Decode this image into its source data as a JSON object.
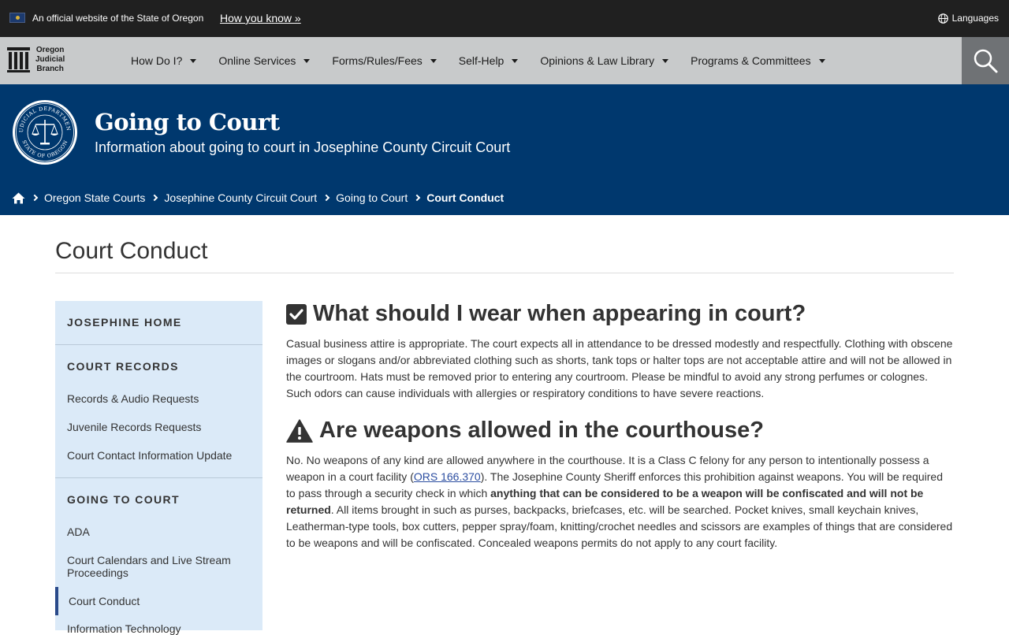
{
  "banner": {
    "official_text": "An official website of the State of Oregon",
    "how_you_know": "How you know »",
    "languages": "Languages"
  },
  "logo": {
    "line1": "Oregon",
    "line2": "Judicial",
    "line3": "Branch"
  },
  "nav": {
    "items": [
      {
        "label": "How Do I?"
      },
      {
        "label": "Online Services"
      },
      {
        "label": "Forms/Rules/Fees"
      },
      {
        "label": "Self-Help"
      },
      {
        "label": "Opinions & Law Library"
      },
      {
        "label": "Programs & Committees"
      }
    ]
  },
  "hero": {
    "title": "Going to Court",
    "subtitle": "Information about going to court in Josephine County Circuit Court",
    "seal_top": "JUDICIAL DEPARTMENT",
    "seal_bottom": "STATE OF OREGON"
  },
  "breadcrumb": {
    "items": [
      "Oregon State Courts",
      "Josephine County Circuit Court",
      "Going to Court"
    ],
    "current": "Court Conduct"
  },
  "page": {
    "title": "Court Conduct"
  },
  "sidebar": {
    "home": "JOSEPHINE HOME",
    "records_heading": "COURT RECORDS",
    "records_links": [
      "Records & Audio Requests",
      "Juvenile Records Requests",
      "Court Contact Information Update"
    ],
    "going_heading": "GOING TO COURT",
    "going_links": [
      "ADA",
      "Court Calendars and Live Stream Proceedings",
      "Court Conduct",
      "Information Technology"
    ]
  },
  "content": {
    "q1": "What should I wear when appearing in court?",
    "a1": "Casual business attire is appropriate. The court expects all in attendance to be dressed modestly and respectfully. Clothing with obscene images or slogans and/or abbreviated clothing such as shorts, tank tops or halter tops are not acceptable attire and will not be allowed in the courtroom. Hats must be removed prior to entering any courtroom. Please be mindful to avoid any strong perfumes or colognes. Such odors can cause individuals with allergies or respiratory conditions to have severe reactions.",
    "q2": "Are weapons allowed in the courthouse?",
    "a2_part1": "No. No weapons of any kind are allowed anywhere in the courthouse. It is a Class C felony for any person to intentionally possess a weapon in a court facility (",
    "a2_link": "ORS 166.370",
    "a2_part2": "). The Josephine County Sheriff enforces this prohibition against weapons. You will be required to pass through a security check in which ",
    "a2_bold": "anything that can be considered to be a weapon will be confiscated and will not be returned",
    "a2_part3": ". All items brought in such as purses, backpacks, briefcases, etc. will be searched. Pocket knives, small keychain knives, Leatherman-type tools, box cutters, pepper spray/foam, knitting/crochet needles and scissors are examples of things that are considered to be weapons and will be confiscated. Concealed weapons permits do not apply to any court facility."
  },
  "colors": {
    "banner_bg": "#202020",
    "nav_bg": "#c8cacb",
    "hero_bg": "#00386e",
    "sidebar_bg": "#dbeaf8",
    "link": "#2b4da0"
  }
}
